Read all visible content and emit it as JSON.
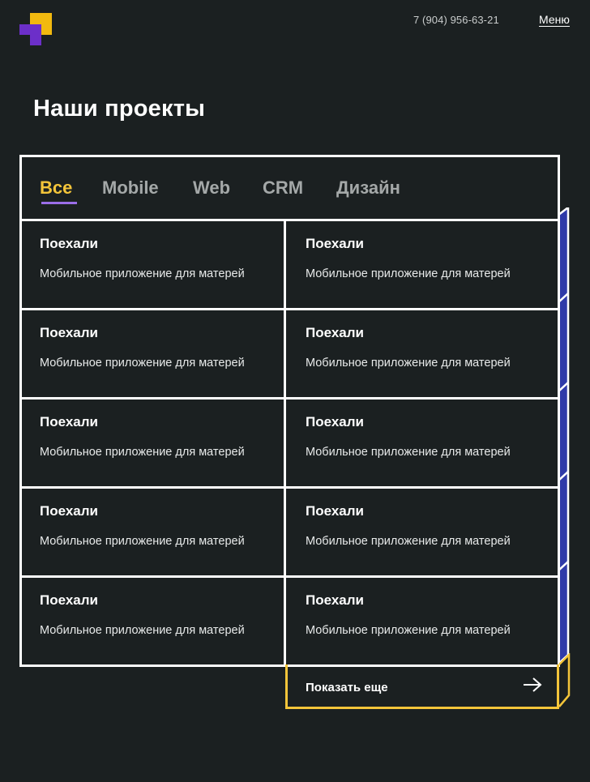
{
  "header": {
    "logo": "logo-icon",
    "phone": "7 (904) 956-63-21",
    "menu_label": "Меню"
  },
  "page": {
    "title": "Наши проекты"
  },
  "tabs": [
    {
      "label": "Все",
      "active": true
    },
    {
      "label": "Mobile",
      "active": false
    },
    {
      "label": "Web",
      "active": false
    },
    {
      "label": "CRM",
      "active": false
    },
    {
      "label": "Дизайн",
      "active": false
    }
  ],
  "projects": [
    {
      "title": "Поехали",
      "description": "Мобильное приложение для матерей"
    },
    {
      "title": "Поехали",
      "description": "Мобильное приложение для матерей"
    },
    {
      "title": "Поехали",
      "description": "Мобильное приложение для матерей"
    },
    {
      "title": "Поехали",
      "description": "Мобильное приложение для матерей"
    },
    {
      "title": "Поехали",
      "description": "Мобильное приложение для матерей"
    },
    {
      "title": "Поехали",
      "description": "Мобильное приложение для матерей"
    },
    {
      "title": "Поехали",
      "description": "Мобильное приложение для матерей"
    },
    {
      "title": "Поехали",
      "description": "Мобильное приложение для матерей"
    },
    {
      "title": "Поехали",
      "description": "Мобильное приложение для матерей"
    },
    {
      "title": "Поехали",
      "description": "Мобильное приложение для матерей"
    }
  ],
  "show_more": {
    "label": "Показать еще",
    "icon": "arrow-right-icon"
  },
  "colors": {
    "background": "#1b2021",
    "accent_yellow": "#f4c53a",
    "accent_purple": "#6c2fc9",
    "side_blue": "#2f3aa8"
  }
}
